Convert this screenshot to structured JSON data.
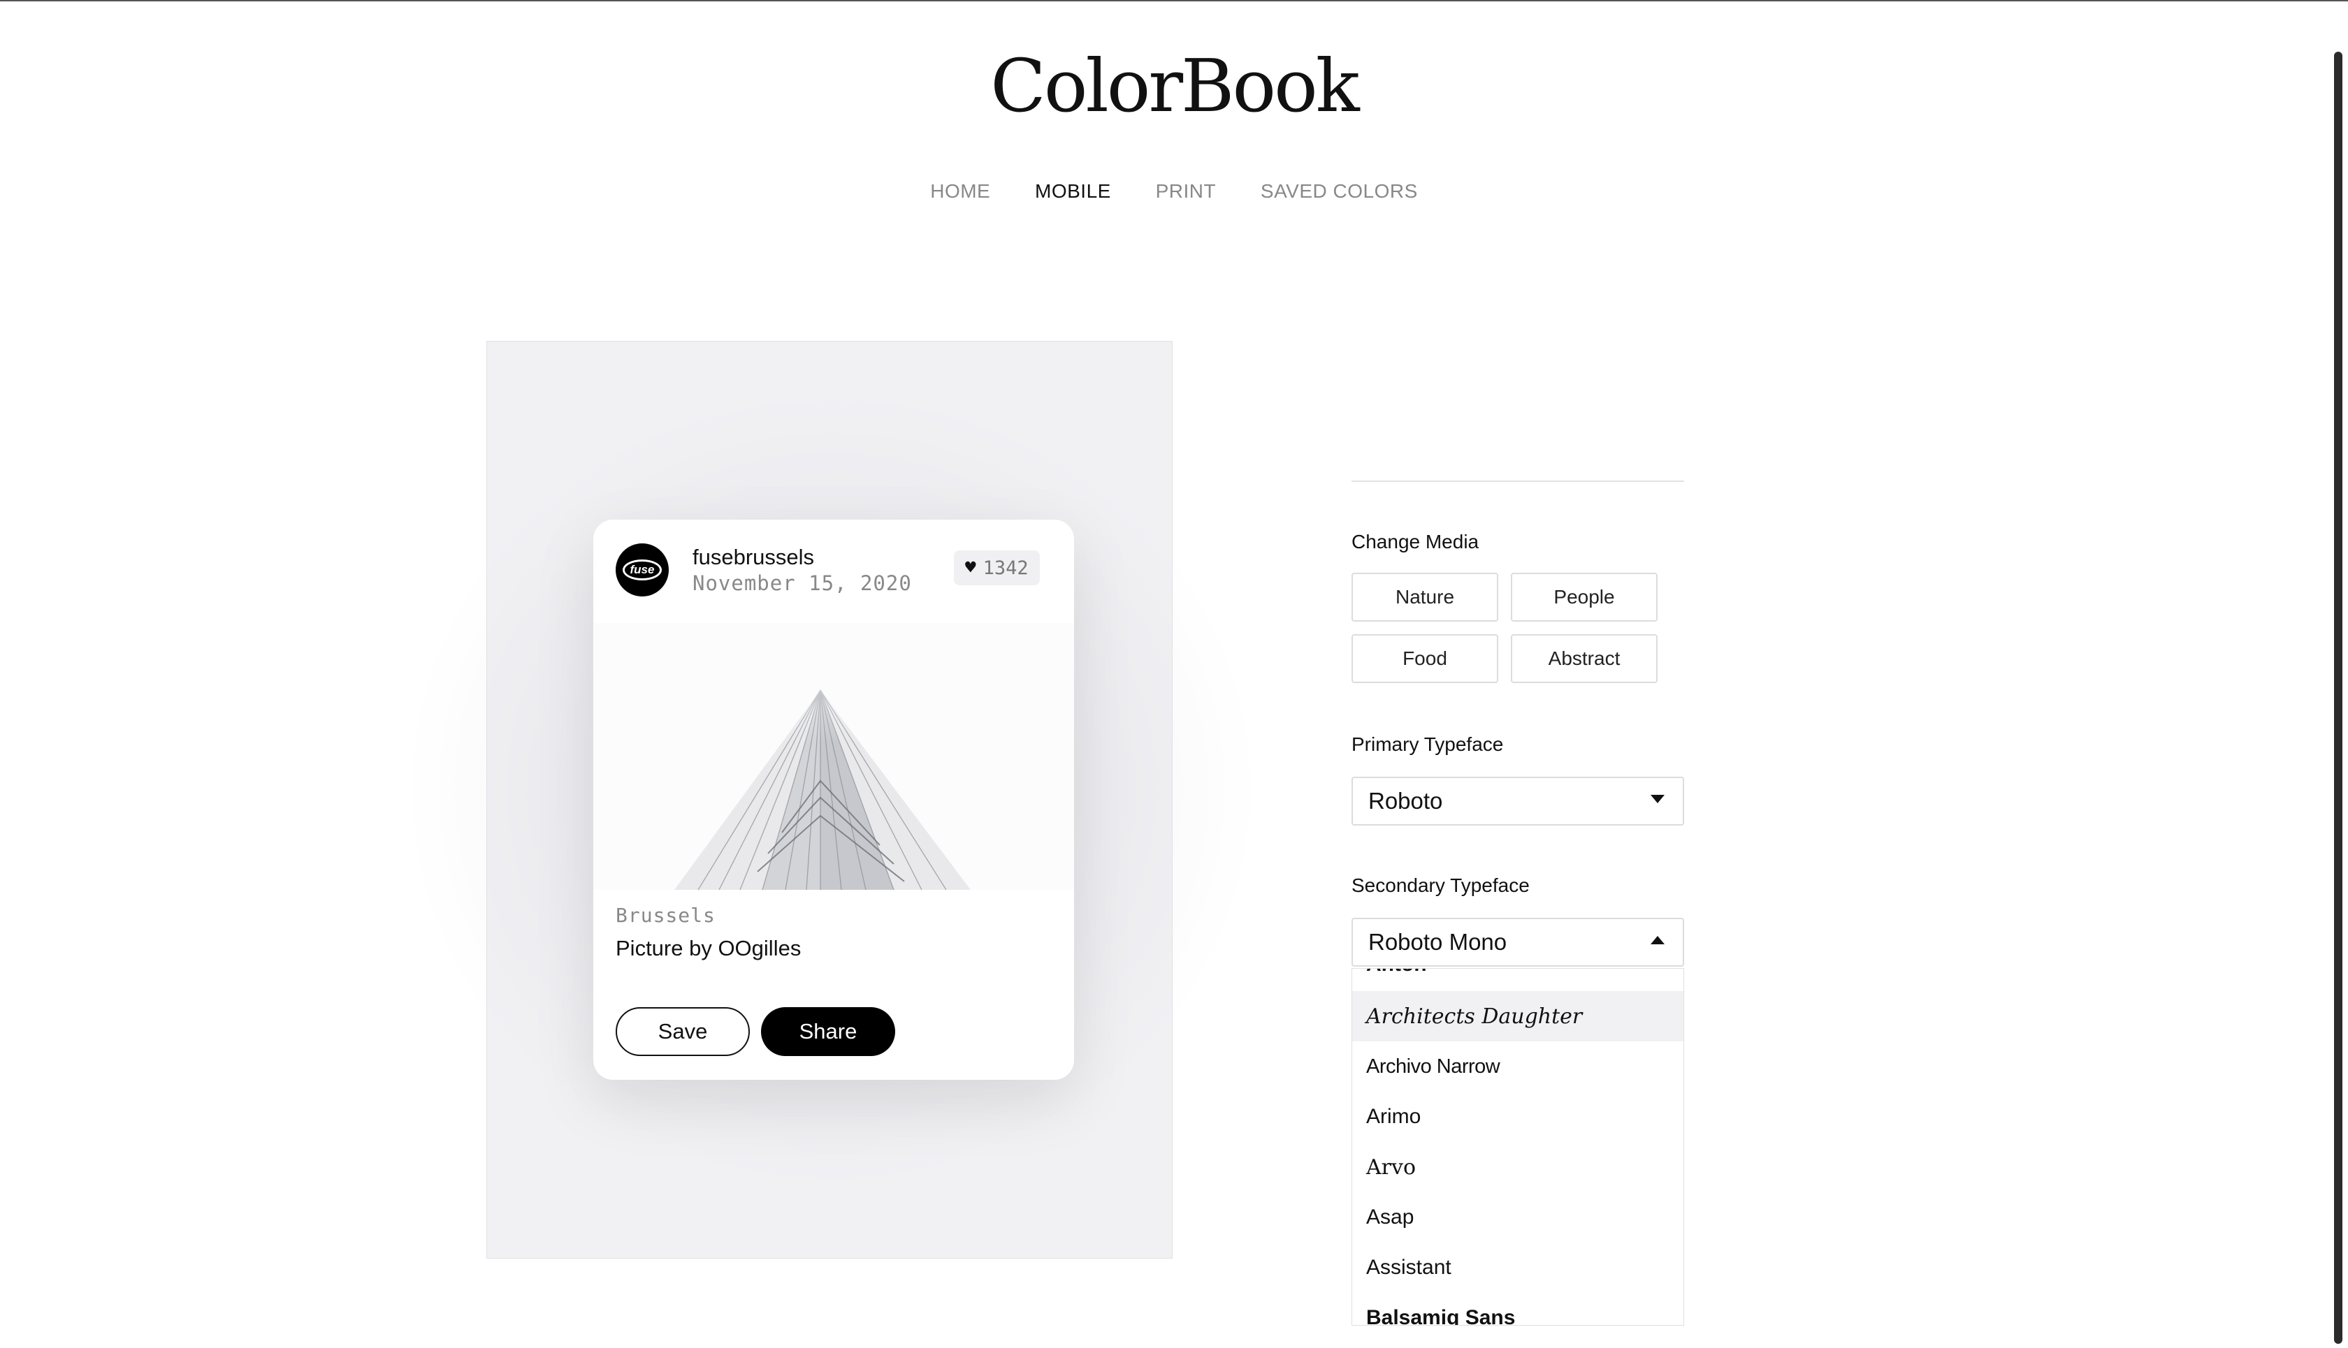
{
  "brand": "ColorBook",
  "nav": [
    "HOME",
    "MOBILE",
    "PRINT",
    "SAVED COLORS"
  ],
  "nav_active": "MOBILE",
  "post": {
    "username": "fusebrussels",
    "date": "November 15, 2020",
    "avatar_text": "fuse",
    "likes": "1342",
    "location": "Brussels",
    "caption": "Picture by OOgilles",
    "save_label": "Save",
    "share_label": "Share"
  },
  "controls": {
    "change_media_label": "Change Media",
    "media_options": [
      "Nature",
      "People",
      "Food",
      "Abstract"
    ],
    "primary_label": "Primary Typeface",
    "primary_value": "Roboto",
    "secondary_label": "Secondary Typeface",
    "secondary_value": "Roboto Mono",
    "font_options": [
      "Anton",
      "Architects Daughter",
      "Archivo Narrow",
      "Arimo",
      "Arvo",
      "Asap",
      "Assistant",
      "Balsamiq Sans"
    ],
    "highlighted_option": "Architects Daughter"
  },
  "icons": {
    "heart": "heart-icon",
    "dropdown_closed": "caret-down-icon",
    "dropdown_open": "caret-up-icon"
  },
  "colors": {
    "accent": "#000000",
    "panel_bg": "#f1f1f4",
    "muted_text": "#888888"
  }
}
